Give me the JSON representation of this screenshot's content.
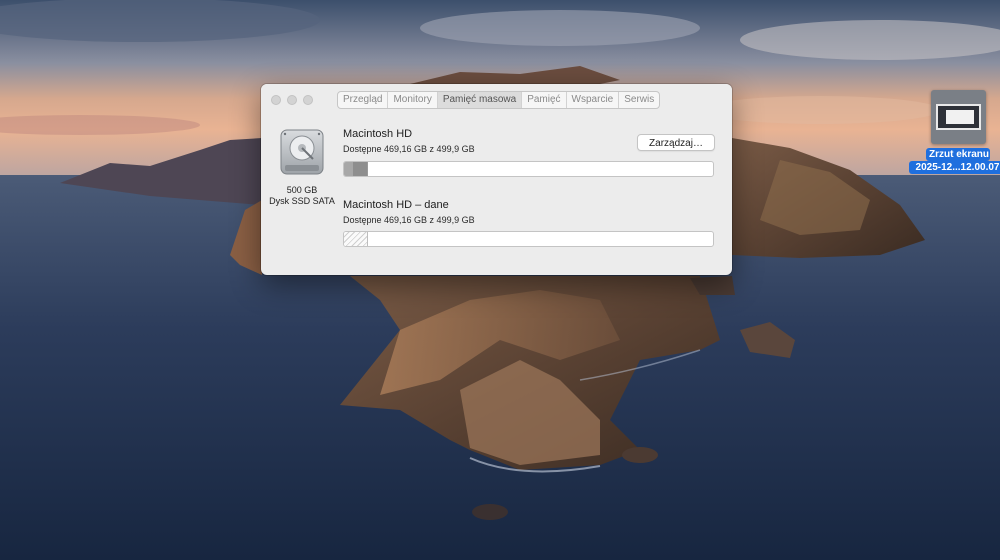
{
  "desktop": {
    "file": {
      "name_line1": "Zrzut ekranu",
      "name_line2": "2025-12...12.00.07",
      "icon": "screenshot-file-icon"
    }
  },
  "window": {
    "tabs": [
      {
        "label": "Przegląd",
        "active": false
      },
      {
        "label": "Monitory",
        "active": false
      },
      {
        "label": "Pamięć masowa",
        "active": true
      },
      {
        "label": "Pamięć",
        "active": false
      },
      {
        "label": "Wsparcie",
        "active": false
      },
      {
        "label": "Serwis",
        "active": false
      }
    ],
    "disk": {
      "icon": "hard-drive-icon",
      "size": "500 GB",
      "type": "Dysk SSD SATA"
    },
    "manage_button": "Zarządzaj…",
    "volumes": [
      {
        "name": "Macintosh HD",
        "available": "Dostępne 469,16 GB z 499,9 GB",
        "used_fraction": 0.0615,
        "style": "solid"
      },
      {
        "name": "Macintosh HD – dane",
        "available": "Dostępne 469,16 GB z 499,9 GB",
        "used_fraction": 0.0615,
        "style": "hatched"
      }
    ]
  },
  "colors": {
    "selection_blue": "#1f6fde",
    "window_bg": "#ececec"
  }
}
